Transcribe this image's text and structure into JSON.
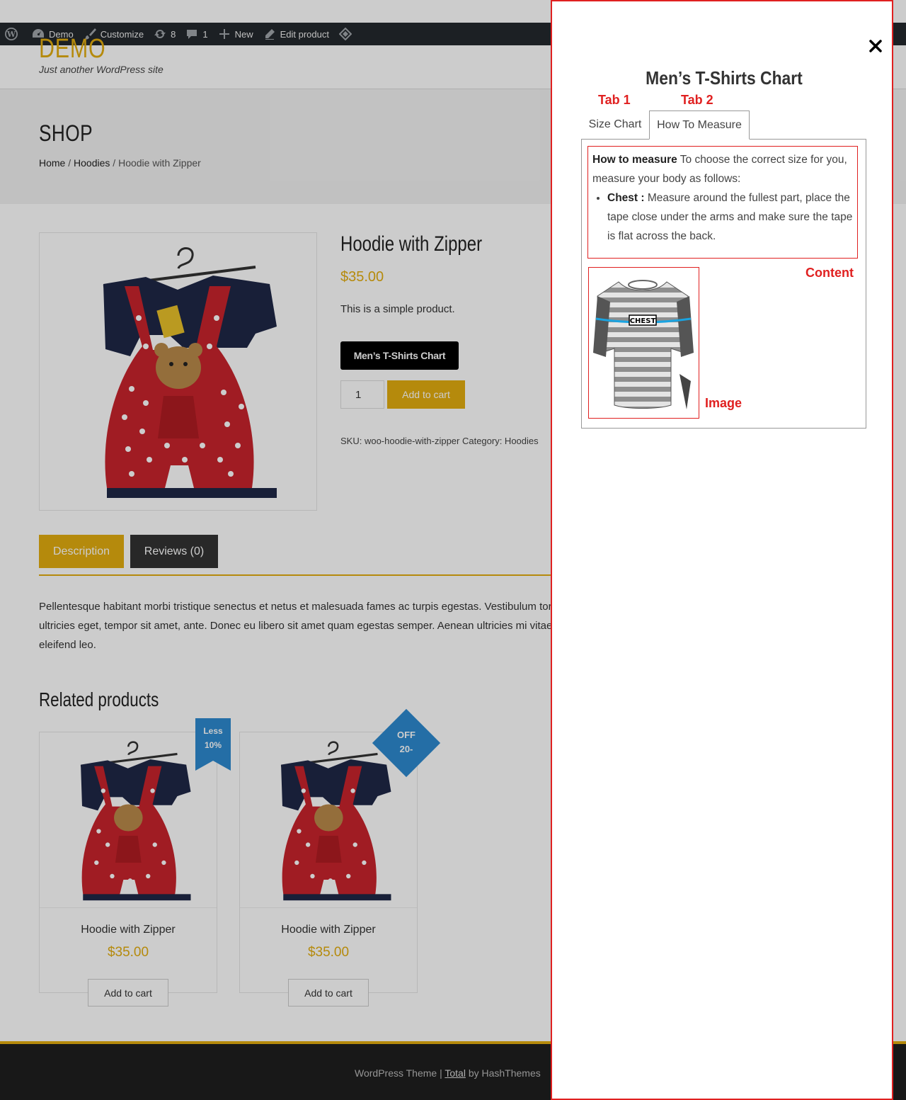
{
  "admin_bar": {
    "site": "Demo",
    "customize": "Customize",
    "updates_count": "8",
    "comments_count": "1",
    "new": "New",
    "edit": "Edit product"
  },
  "site": {
    "title": "DEMO",
    "tagline": "Just another WordPress site"
  },
  "banner": {
    "title": "SHOP",
    "breadcrumb": [
      "Home",
      "Hoodies",
      "Hoodie with Zipper"
    ],
    "breadcrumb_sep": " / "
  },
  "product": {
    "title": "Hoodie with Zipper",
    "price": "$35.00",
    "short_description": "This is a simple product.",
    "chart_button": "Men’s T-Shirts Chart",
    "quantity": "1",
    "add_to_cart": "Add to cart",
    "meta": "SKU: woo-hoodie-with-zipper Category: Hoodies"
  },
  "tabs": {
    "description": "Description",
    "reviews": "Reviews (0)"
  },
  "description_text": "Pellentesque habitant morbi tristique senectus et netus et malesuada fames ac turpis egestas. Vestibulum tortor quam, feugiat vitae, ultricies eget, tempor sit amet, ante. Donec eu libero sit amet quam egestas semper. Aenean ultricies mi vitae est. Mauris placerat eleifend leo.",
  "related": {
    "title": "Related products",
    "items": [
      {
        "name": "Hoodie with Zipper",
        "price": "$35.00",
        "button": "Add to cart",
        "badge_line1": "Less",
        "badge_line2": "10%"
      },
      {
        "name": "Hoodie with Zipper",
        "price": "$35.00",
        "button": "Add to cart",
        "badge_line1": "OFF",
        "badge_line2": "20-"
      }
    ]
  },
  "footer": {
    "prefix": "WordPress Theme | ",
    "theme": "Total",
    "suffix": " by HashThemes"
  },
  "panel": {
    "title": "Men’s T-Shirts Chart",
    "tab1_label": "Size Chart",
    "tab2_label": "How To Measure",
    "annotations": {
      "tab1": "Tab 1",
      "tab2": "Tab 2",
      "content": "Content",
      "image": "Image"
    },
    "measure_heading": "How to measure",
    "measure_intro": " To choose the correct size for you, measure your body as follows:",
    "chest_label": "Chest :",
    "chest_text": " Measure around the fullest part, place the tape close under the arms and make sure the tape is flat across the back.",
    "image_label": "CHEST"
  },
  "colors": {
    "accent": "#e3ad0f",
    "annotation": "#e02020",
    "admin_bar": "#23282d",
    "ribbon": "#2e8ad0"
  },
  "icons": [
    "wordpress-icon",
    "dashboard-icon",
    "brush-icon",
    "refresh-icon",
    "comment-icon",
    "plus-icon",
    "pencil-icon",
    "diamond-icon",
    "close-icon"
  ]
}
